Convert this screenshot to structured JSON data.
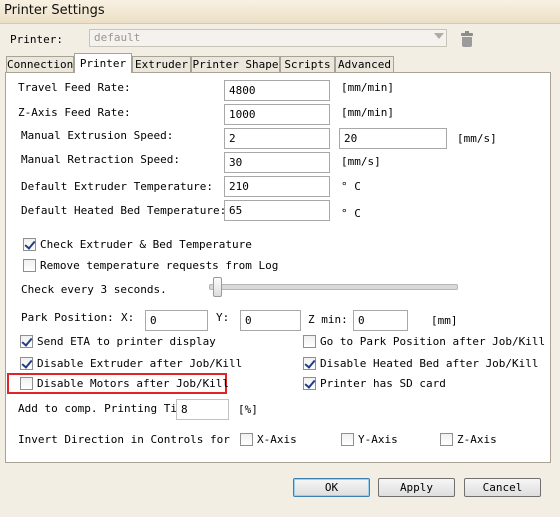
{
  "window": {
    "title": "Printer Settings"
  },
  "printer_select": {
    "label": "Printer:",
    "value": "default"
  },
  "tabs": [
    {
      "label": "Connection"
    },
    {
      "label": "Printer"
    },
    {
      "label": "Extruder"
    },
    {
      "label": "Printer Shape"
    },
    {
      "label": "Scripts"
    },
    {
      "label": "Advanced"
    }
  ],
  "settings": {
    "travel_feed_rate": {
      "label": "Travel Feed Rate:",
      "value": "4800",
      "unit": "[mm/min]"
    },
    "z_axis_feed_rate": {
      "label": "Z-Axis Feed Rate:",
      "value": "1000",
      "unit": "[mm/min]"
    },
    "manual_extrusion_speed": {
      "label": "Manual Extrusion Speed:",
      "value1": "2",
      "value2": "20",
      "unit": "[mm/s]"
    },
    "manual_retraction_speed": {
      "label": "Manual Retraction Speed:",
      "value": "30",
      "unit": "[mm/s]"
    },
    "default_extruder_temp": {
      "label": "Default Extruder Temperature:",
      "value": "210",
      "unit": "° C"
    },
    "default_bed_temp": {
      "label": "Default Heated Bed Temperature:",
      "value": "65",
      "unit": "° C"
    },
    "check_temperature": {
      "label": "Check Extruder & Bed Temperature",
      "checked": true
    },
    "remove_temp_requests": {
      "label": "Remove temperature requests from Log",
      "checked": false
    },
    "check_every": {
      "label": "Check every 3 seconds.",
      "slider_fraction": 0.03
    },
    "park_position": {
      "label": "Park Position:",
      "x_label": "X:",
      "x": "0",
      "y_label": "Y:",
      "y": "0",
      "zmin_label": "Z min:",
      "zmin": "0",
      "unit": "[mm]"
    },
    "send_eta": {
      "label": "Send ETA to printer display",
      "checked": true
    },
    "go_to_park": {
      "label": "Go to Park Position after Job/Kill",
      "checked": false
    },
    "disable_extruder": {
      "label": "Disable Extruder after Job/Kill",
      "checked": true
    },
    "disable_heated_bed": {
      "label": "Disable Heated Bed after Job/Kill",
      "checked": true
    },
    "disable_motors": {
      "label": "Disable Motors after Job/Kill",
      "checked": false
    },
    "has_sd_card": {
      "label": "Printer has SD card",
      "checked": true
    },
    "add_to_comp_time": {
      "label": "Add to comp. Printing Time",
      "value": "8",
      "unit": "[%]"
    },
    "invert_direction": {
      "label": "Invert Direction in Controls for",
      "x_axis": "X-Axis",
      "y_axis": "Y-Axis",
      "z_axis": "Z-Axis"
    }
  },
  "buttons": {
    "ok": "OK",
    "apply": "Apply",
    "cancel": "Cancel"
  },
  "colors": {
    "highlight": "#e02424",
    "check": "#1e3f86"
  }
}
